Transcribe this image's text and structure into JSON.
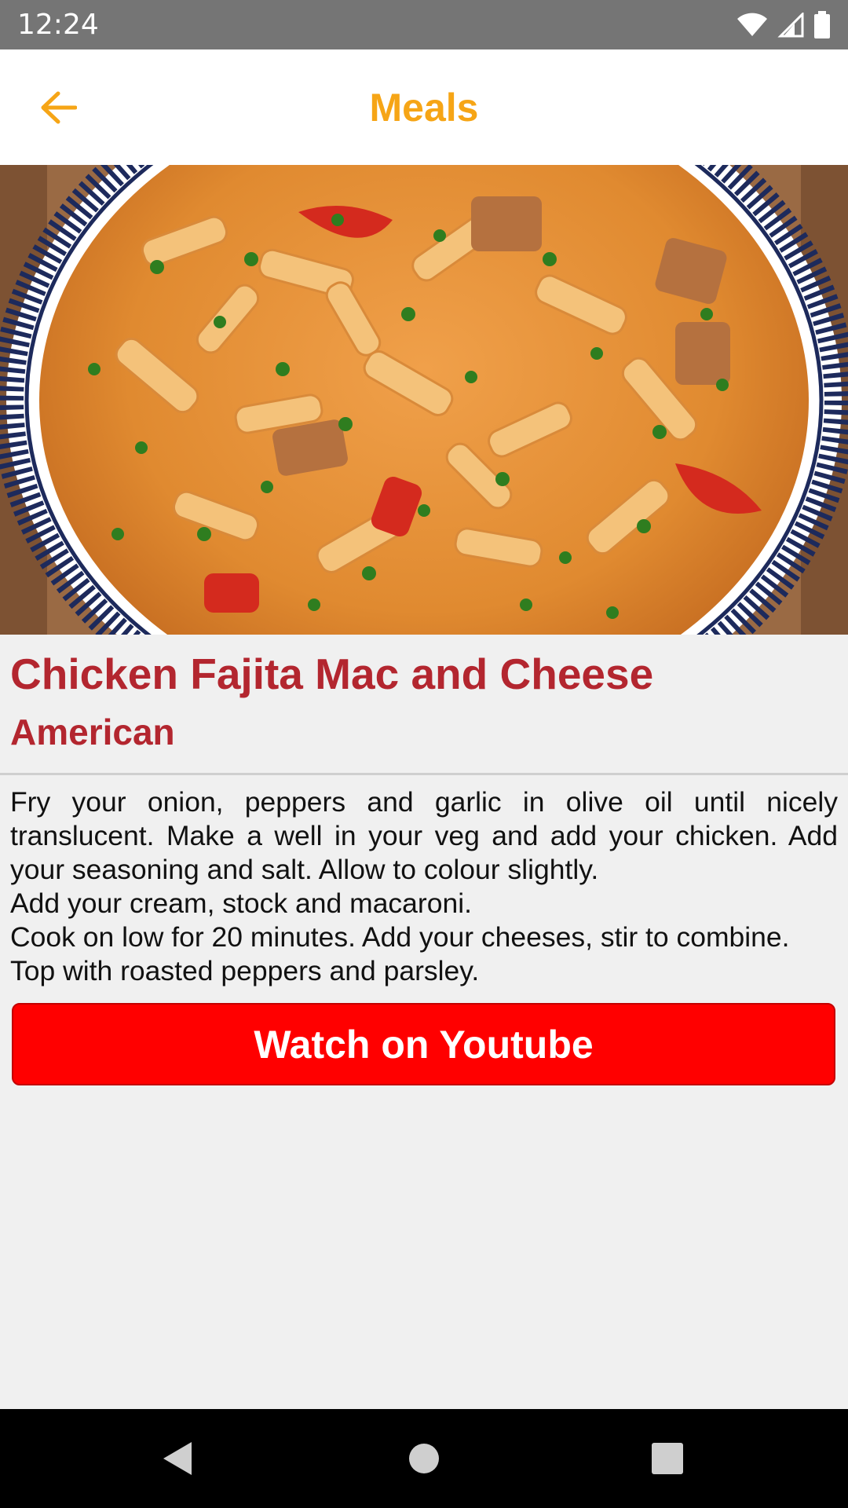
{
  "status_bar": {
    "time": "12:24",
    "icons": [
      "wifi-icon",
      "signal-icon",
      "battery-icon"
    ]
  },
  "app_bar": {
    "title": "Meals",
    "back_icon": "arrow-left-icon",
    "accent_color": "#f6a516"
  },
  "meal": {
    "name": "Chicken Fajita Mac and Cheese",
    "area": "American",
    "instructions": "Fry your onion, peppers and garlic in olive oil until nicely translucent. Make a well in your veg and add your chicken. Add your seasoning and salt. Allow to colour slightly.\nAdd your cream, stock and macaroni.\nCook on low for 20 minutes. Add your cheeses, stir to combine.\nTop with roasted peppers and parsley.",
    "title_color": "#b3262f"
  },
  "actions": {
    "youtube_label": "Watch on Youtube",
    "youtube_color": "#ff0000"
  },
  "nav_bar": {
    "icons": [
      "back-triangle-icon",
      "home-circle-icon",
      "recents-square-icon"
    ]
  }
}
